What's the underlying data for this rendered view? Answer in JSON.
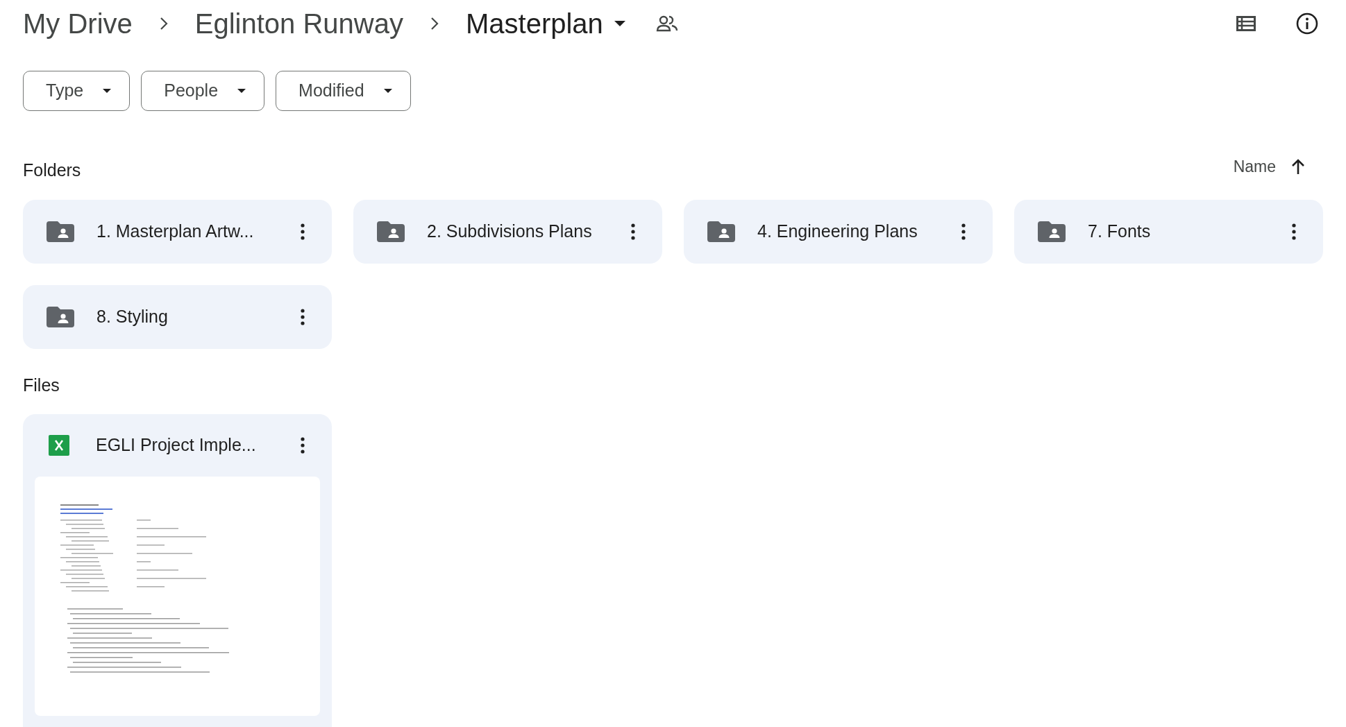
{
  "breadcrumb": [
    {
      "label": "My Drive"
    },
    {
      "label": "Eglinton Runway"
    },
    {
      "label": "Masterplan"
    }
  ],
  "filters": [
    {
      "label": "Type"
    },
    {
      "label": "People"
    },
    {
      "label": "Modified"
    }
  ],
  "folders_section": {
    "title": "Folders",
    "sort": {
      "label": "Name"
    }
  },
  "folders": [
    {
      "name": "1. Masterplan Artw..."
    },
    {
      "name": "2. Subdivisions Plans"
    },
    {
      "name": "4. Engineering Plans"
    },
    {
      "name": "7. Fonts"
    },
    {
      "name": "8. Styling"
    }
  ],
  "files_section": {
    "title": "Files"
  },
  "files": [
    {
      "name": "EGLI Project Imple..."
    }
  ]
}
